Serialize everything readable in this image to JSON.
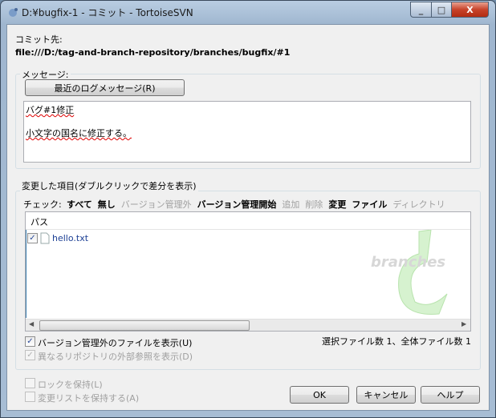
{
  "window": {
    "title": "D:¥bugfix-1 - コミット - TortoiseSVN",
    "minimize": "_",
    "maximize": "□",
    "close": "X"
  },
  "commit_to": {
    "label": "コミット先:",
    "url": "file:///D:/tag-and-branch-repository/branches/bugfix/#1"
  },
  "message": {
    "group_label": "メッセージ:",
    "recent_button": "最近のログメッセージ(R)",
    "line1": "バグ#1修正",
    "line2": "小文字の国名に修正する。"
  },
  "changes": {
    "group_label": "変更した項目(ダブルクリックで差分を表示)",
    "check_label": "チェック:",
    "filters": [
      {
        "label": "すべて",
        "enabled": true
      },
      {
        "label": "無し",
        "enabled": true
      },
      {
        "label": "バージョン管理外",
        "enabled": false
      },
      {
        "label": "バージョン管理開始",
        "enabled": true
      },
      {
        "label": "追加",
        "enabled": false
      },
      {
        "label": "削除",
        "enabled": false
      },
      {
        "label": "変更",
        "enabled": true
      },
      {
        "label": "ファイル",
        "enabled": true
      },
      {
        "label": "ディレクトリ",
        "enabled": false
      }
    ],
    "column_path": "パス",
    "files": [
      {
        "name": "hello.txt",
        "checked": true
      }
    ],
    "watermark": "branches",
    "show_unversioned": "バージョン管理外のファイルを表示(U)",
    "show_externals": "異なるリポジトリの外部参照を表示(D)",
    "count": "選択ファイル数 1、全体ファイル数 1"
  },
  "options": {
    "keep_locks": "ロックを保持(L)",
    "keep_changelists": "変更リストを保持する(A)"
  },
  "buttons": {
    "ok": "OK",
    "cancel": "キャンセル",
    "help": "ヘルプ"
  }
}
